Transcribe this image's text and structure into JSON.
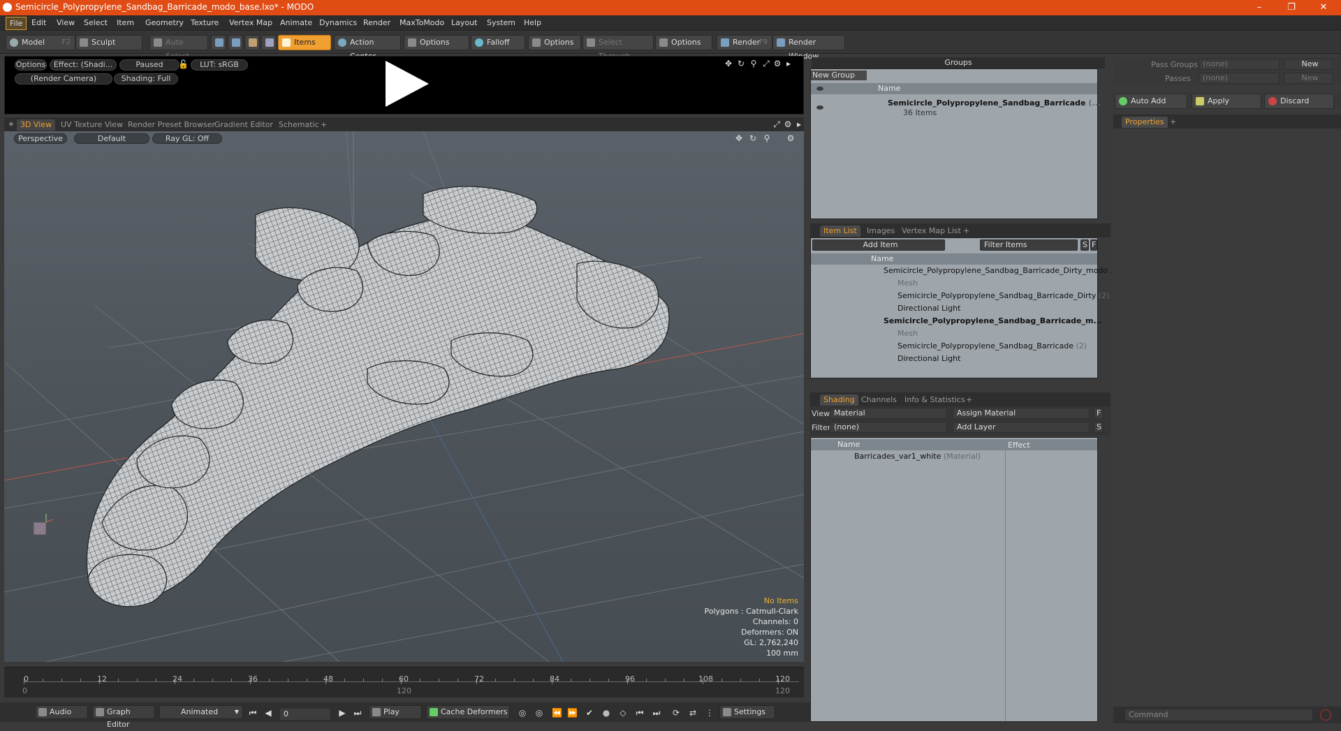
{
  "window": {
    "title": "Semicircle_Polypropylene_Sandbag_Barricade_modo_base.lxo* - MODO",
    "controls": [
      "–",
      "❐",
      "✕"
    ]
  },
  "menu": [
    "File",
    "Edit",
    "View",
    "Select",
    "Item",
    "Geometry",
    "Texture",
    "Vertex Map",
    "Animate",
    "Dynamics",
    "Render",
    "MaxToModo",
    "Layout",
    "System",
    "Help"
  ],
  "toolbar": {
    "model": "Model",
    "model_key": "F2",
    "sculpt": "Sculpt",
    "auto_select": "Auto Select",
    "items": "Items",
    "action_center": "Action Center",
    "options1": "Options",
    "falloff": "Falloff",
    "options2": "Options",
    "select_through": "Select Through",
    "options3": "Options",
    "render": "Render",
    "render_key": "F9",
    "render_window": "Render Window"
  },
  "preview": {
    "options": "Options",
    "effect": "Effect: (Shadi...",
    "paused": "Paused",
    "lut": "LUT: sRGB",
    "camera": "(Render Camera)",
    "shading": "Shading: Full"
  },
  "viewport_tabs": [
    "3D View",
    "UV Texture View",
    "Render Preset Browser",
    "Gradient Editor",
    "Schematic",
    "+"
  ],
  "viewport": {
    "perspective": "Perspective",
    "default": "Default",
    "raygl": "Ray GL: Off",
    "stats": {
      "no_items": "No Items",
      "polygons": "Polygons : Catmull-Clark",
      "channels": "Channels: 0",
      "deformers": "Deformers: ON",
      "gl": "GL: 2,762,240",
      "scale": "100 mm"
    }
  },
  "timeline": {
    "labels": [
      "0",
      "12",
      "24",
      "36",
      "48",
      "60",
      "72",
      "84",
      "96",
      "108",
      "120"
    ],
    "sub_labels": [
      "0",
      "120",
      "120"
    ]
  },
  "bottom": {
    "audio": "Audio",
    "graph_editor": "Graph Editor",
    "animated": "Animated",
    "frame": "0",
    "play": "Play",
    "cache_deformers": "Cache Deformers",
    "settings": "Settings"
  },
  "groups": {
    "title": "Groups",
    "new_group": "New Group",
    "col_name": "Name",
    "item_name": "Semicircle_Polypropylene_Sandbag_Barricade",
    "item_suffix": "(...",
    "item_count": "36 Items"
  },
  "item_list": {
    "tabs": [
      "Item List",
      "Images",
      "Vertex Map List",
      "+"
    ],
    "add_item": "Add Item",
    "filter": "Filter Items",
    "s": "S",
    "f": "F",
    "col_name": "Name",
    "rows": [
      {
        "label": "Semicircle_Polypropylene_Sandbag_Barricade_Dirty_modo ...",
        "suffix": ""
      },
      {
        "label": "Mesh",
        "suffix": ""
      },
      {
        "label": "Semicircle_Polypropylene_Sandbag_Barricade_Dirty",
        "suffix": "(2)"
      },
      {
        "label": "Directional Light",
        "suffix": ""
      },
      {
        "label": "Semicircle_Polypropylene_Sandbag_Barricade_m...",
        "suffix": ""
      },
      {
        "label": "Mesh",
        "suffix": ""
      },
      {
        "label": "Semicircle_Polypropylene_Sandbag_Barricade",
        "suffix": "(2)"
      },
      {
        "label": "Directional Light",
        "suffix": ""
      }
    ]
  },
  "shading": {
    "tabs": [
      "Shading",
      "Channels",
      "Info & Statistics",
      "+"
    ],
    "view_label": "View",
    "view_value": "Material",
    "assign_material": "Assign Material",
    "filter_label": "Filter",
    "filter_value": "(none)",
    "add_layer": "Add Layer",
    "f": "F",
    "s": "S",
    "col_name": "Name",
    "col_effect": "Effect",
    "row_name": "Barricades_var1_white",
    "row_type": "(Material)"
  },
  "properties": {
    "pass_groups_label": "Pass Groups",
    "pass_groups_value": "(none)",
    "passes_label": "Passes",
    "passes_value": "(none)",
    "new1": "New",
    "new2": "New",
    "auto_add": "Auto Add",
    "apply": "Apply",
    "discard": "Discard",
    "tab": "Properties",
    "plus": "+",
    "command_placeholder": "Command"
  }
}
